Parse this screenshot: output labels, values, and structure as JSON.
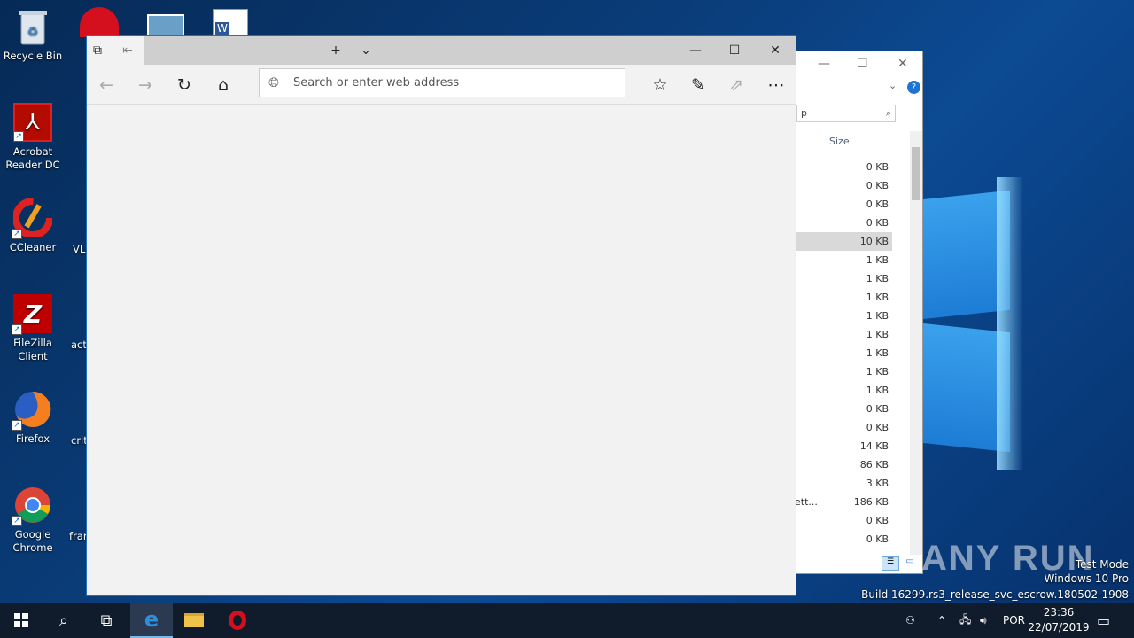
{
  "desktop": {
    "icons": [
      {
        "label": "Recycle Bin"
      },
      {
        "label": "Acrobat Reader DC"
      },
      {
        "label": "CCleaner"
      },
      {
        "label": "FileZilla Client"
      },
      {
        "label": "Firefox"
      },
      {
        "label": "Google Chrome"
      }
    ],
    "partial_labels": [
      "VL",
      "acti",
      "crit",
      "fran"
    ]
  },
  "explorer": {
    "search_text": "p",
    "column_header": "Size",
    "sizes": [
      "0 KB",
      "0 KB",
      "0 KB",
      "0 KB",
      "10 KB",
      "1 KB",
      "1 KB",
      "1 KB",
      "1 KB",
      "1 KB",
      "1 KB",
      "1 KB",
      "1 KB",
      "0 KB",
      "0 KB",
      "14 KB",
      "86 KB",
      "3 KB",
      "186 KB",
      "0 KB",
      "0 KB"
    ],
    "partial_name": "ett..."
  },
  "edge": {
    "address_placeholder": "Search or enter web address"
  },
  "taskbar": {
    "language": "POR",
    "time": "23:36",
    "date": "22/07/2019"
  },
  "watermark": {
    "line1": "Test Mode",
    "line2": "Windows 10 Pro",
    "line3": "Build 16299.rs3_release_svc_escrow.180502-1908",
    "brand": "ANY RUN"
  }
}
